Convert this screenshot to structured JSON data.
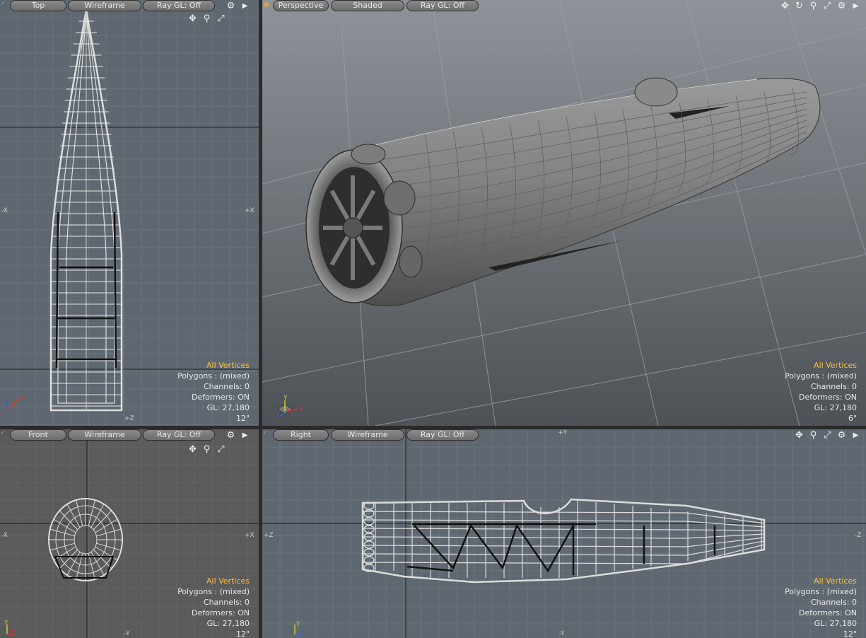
{
  "viewports": {
    "top": {
      "view_label": "Top",
      "shade_label": "Wireframe",
      "raygl_label": "Ray GL: Off",
      "info": {
        "selection": "All Vertices",
        "polygons": "Polygons : (mixed)",
        "channels": "Channels: 0",
        "deformers": "Deformers: ON",
        "gl": "GL: 27,180",
        "scale": "12\""
      },
      "axes": {
        "left": "-X",
        "right": "+X",
        "bottom": "+Z"
      }
    },
    "perspective": {
      "view_label": "Perspective",
      "shade_label": "Shaded",
      "raygl_label": "Ray GL: Off",
      "info": {
        "selection": "All Vertices",
        "polygons": "Polygons : (mixed)",
        "channels": "Channels: 0",
        "deformers": "Deformers: ON",
        "gl": "GL: 27,180",
        "scale": "6\""
      }
    },
    "front": {
      "view_label": "Front",
      "shade_label": "Wireframe",
      "raygl_label": "Ray GL: Off",
      "info": {
        "selection": "All Vertices",
        "polygons": "Polygons : (mixed)",
        "channels": "Channels: 0",
        "deformers": "Deformers: ON",
        "gl": "GL: 27,180",
        "scale": "12\""
      },
      "axes": {
        "left": "-X",
        "right": "+X",
        "bottom": "-Y"
      }
    },
    "right": {
      "view_label": "Right",
      "shade_label": "Wireframe",
      "raygl_label": "Ray GL: Off",
      "info": {
        "selection": "All Vertices",
        "polygons": "Polygons : (mixed)",
        "channels": "Channels: 0",
        "deformers": "Deformers: ON",
        "gl": "GL: 27,180",
        "scale": "12\""
      },
      "axes": {
        "left": "+Z",
        "right": "-Z",
        "top": "+Y",
        "bottom": "-Y"
      }
    }
  },
  "gizmo_labels": {
    "x": "X",
    "y": "Y",
    "z": "Z"
  },
  "icons": {
    "move": "move-icon",
    "rotate": "rotate-icon",
    "zoom": "zoom-icon",
    "maximize": "maximize-icon",
    "settings": "gear-icon",
    "menu": "arrow-right-icon"
  },
  "colors": {
    "highlight": "#ffbf3a",
    "axis_x": "#d33",
    "axis_y": "#cc3",
    "axis_z": "#36c"
  }
}
